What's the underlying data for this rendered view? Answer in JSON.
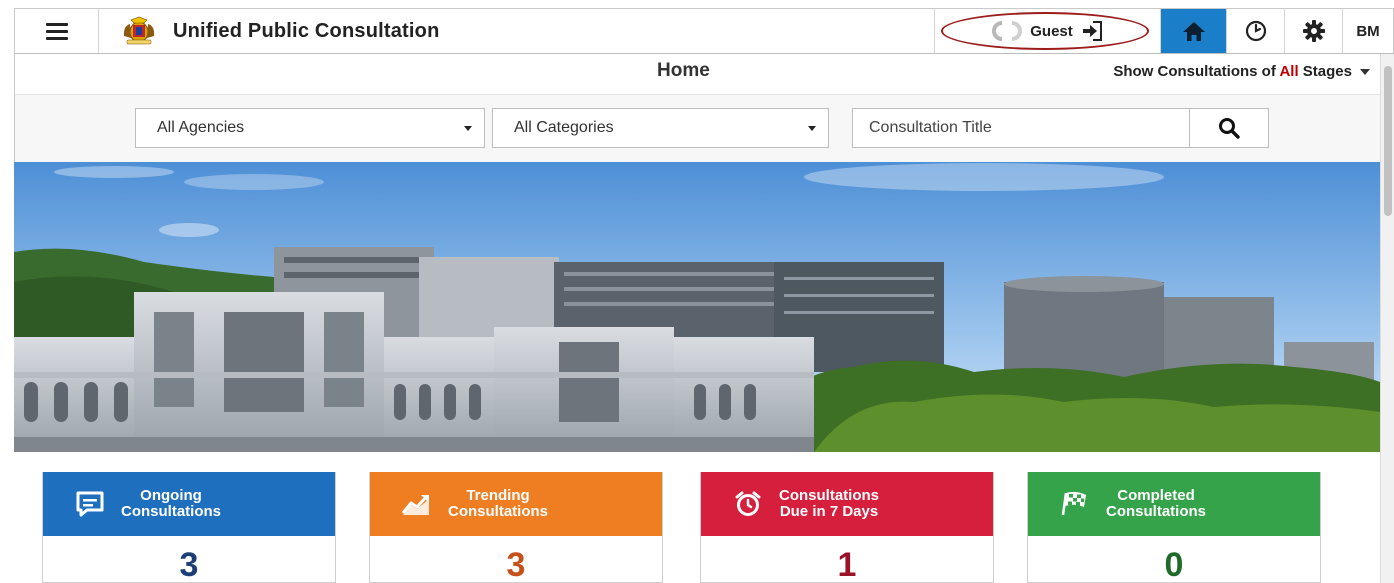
{
  "header": {
    "app_title": "Unified Public Consultation",
    "guest_label": "Guest",
    "language": "BM"
  },
  "subheader": {
    "page_title": "Home",
    "stage_filter_prefix": "Show Consultations of",
    "stage_filter_value": "All",
    "stage_filter_suffix": "Stages"
  },
  "filters": {
    "agency_selected": "All Agencies",
    "category_selected": "All Categories",
    "search_placeholder": "Consultation Title"
  },
  "stats": [
    {
      "title": "Ongoing Consultations",
      "title_line1": "Ongoing",
      "title_line2": "Consultations",
      "count": "3",
      "color": "#1f6fbf",
      "count_color": "#1d3f78",
      "icon": "message-icon"
    },
    {
      "title": "Trending Consultations",
      "title_line1": "Trending",
      "title_line2": "Consultations",
      "count": "3",
      "color": "#ef7d22",
      "count_color": "#c4501a",
      "icon": "trend-chart-icon"
    },
    {
      "title": "Consultations Due in 7 Days",
      "title_line1": "Consultations",
      "title_line2": "Due in 7 Days",
      "count": "1",
      "color": "#d51f3d",
      "count_color": "#9b1128",
      "icon": "alarm-clock-icon"
    },
    {
      "title": "Completed Consultations",
      "title_line1": "Completed",
      "title_line2": "Consultations",
      "count": "0",
      "color": "#34a34a",
      "count_color": "#1f6b2b",
      "icon": "checkered-flag-icon"
    }
  ]
}
